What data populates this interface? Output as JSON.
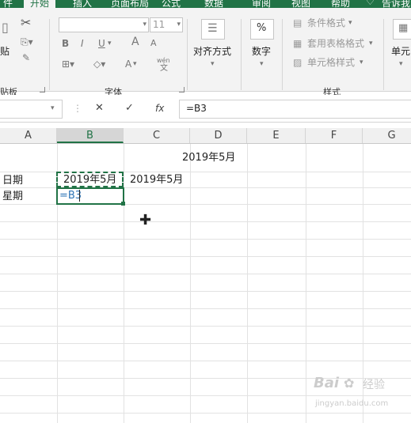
{
  "tabs": [
    {
      "label": "件",
      "active": false
    },
    {
      "label": "开始",
      "active": true
    },
    {
      "label": "插入",
      "active": false
    },
    {
      "label": "页面布局",
      "active": false
    },
    {
      "label": "公式",
      "active": false
    },
    {
      "label": "数据",
      "active": false
    },
    {
      "label": "审阅",
      "active": false
    },
    {
      "label": "视图",
      "active": false
    },
    {
      "label": "帮助",
      "active": false
    },
    {
      "label": "告诉我",
      "active": false
    }
  ],
  "ribbon": {
    "clipboard_label": "贴板",
    "paste_label": "贴",
    "font_group_label": "字体",
    "font_size": "11",
    "bold": "B",
    "italic": "I",
    "underline": "U",
    "grow_font": "A",
    "shrink_font": "A",
    "wen": "wén",
    "wen_sub": "文",
    "align_label": "对齐方式",
    "number_label": "数字",
    "number_icon": "%",
    "cond_format": "条件格式",
    "table_format": "套用表格格式",
    "cell_style": "单元格样式",
    "styles_group_label": "样式",
    "cells_label": "单元"
  },
  "formula_bar": {
    "cancel": "✕",
    "enter": "✓",
    "fx": "fx",
    "formula": "=B3"
  },
  "columns": [
    "A",
    "B",
    "C",
    "D",
    "E",
    "F",
    "G"
  ],
  "cells": {
    "d1": "2019年5月",
    "a3": "日期",
    "a4": "星期",
    "b3": "2019年5月",
    "c3": "2019年5月",
    "b4": "=B3"
  },
  "watermark": {
    "brand": "Bai",
    "suffix": "经验",
    "url": "jingyan.baidu.com"
  },
  "colors": {
    "excel_green": "#217346",
    "formula_blue": "#2e75b6"
  }
}
